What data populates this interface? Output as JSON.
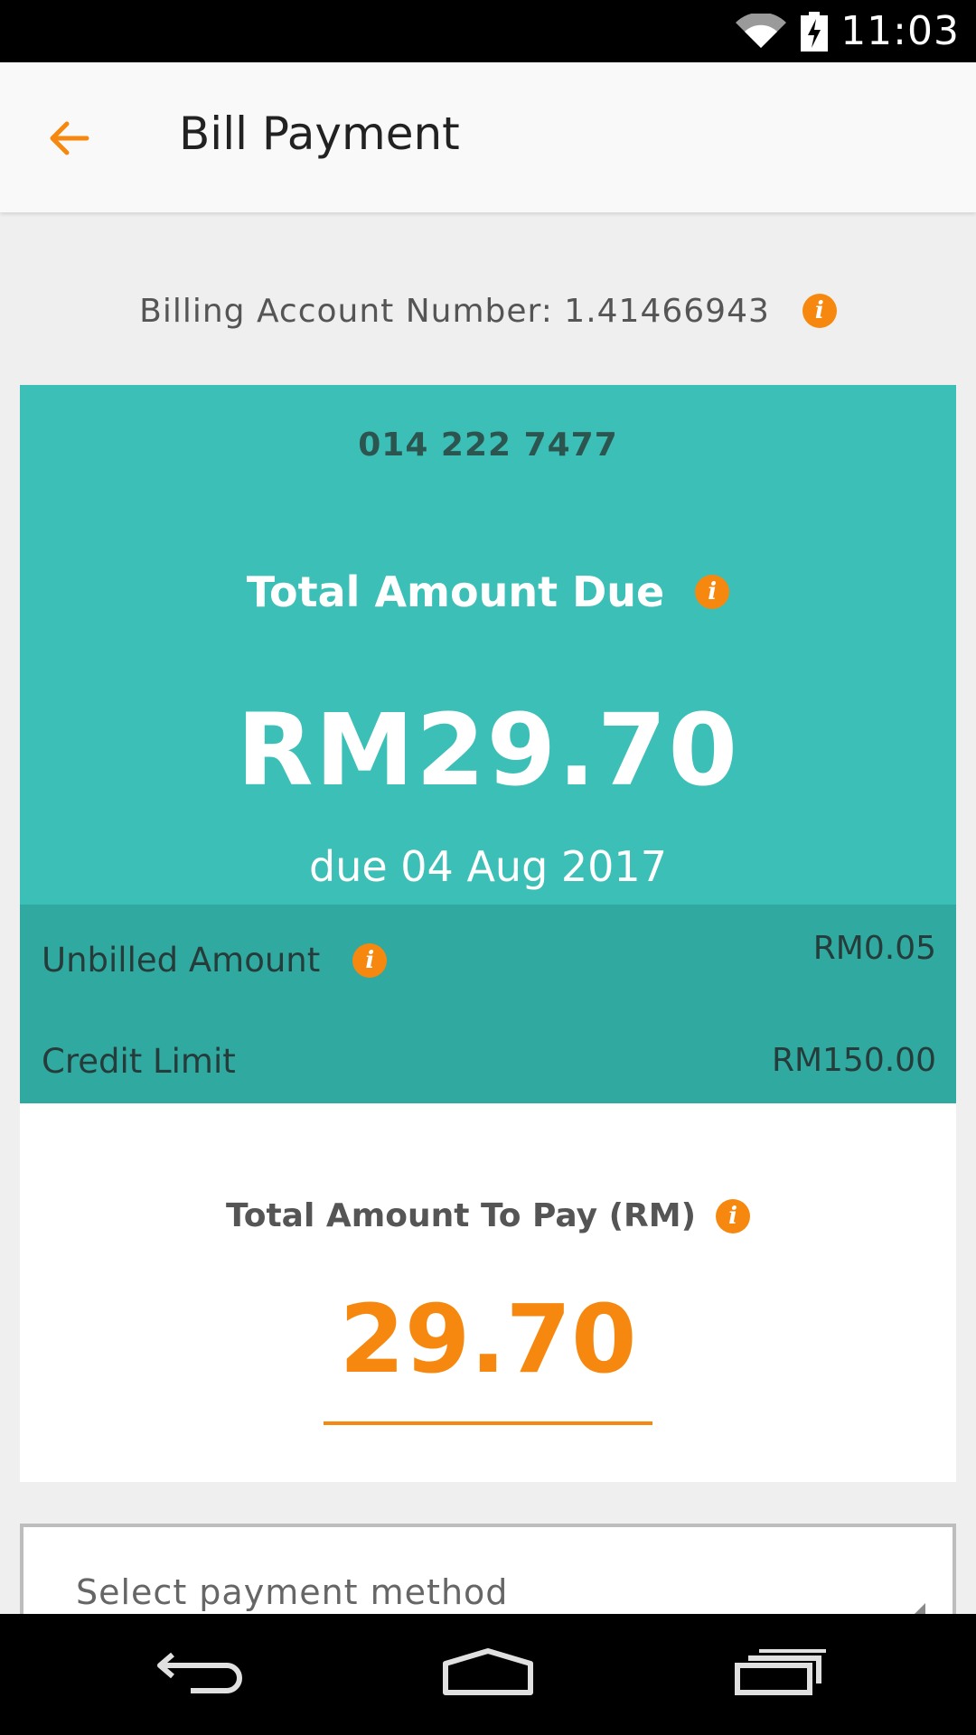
{
  "status_bar": {
    "time": "11:03",
    "icons": [
      "wifi-icon",
      "battery-charging-icon"
    ]
  },
  "header": {
    "title": "Bill Payment",
    "back_icon": "arrow-left-icon"
  },
  "account": {
    "label": "Billing Account Number: 1.41466943",
    "info_icon": "info-icon"
  },
  "due_card": {
    "phone_number": "014 222 7477",
    "label": "Total Amount Due",
    "amount": "RM29.70",
    "due_date": "due 04 Aug 2017"
  },
  "summary": {
    "unbilled_label": "Unbilled Amount",
    "unbilled_value": "RM0.05",
    "credit_label": "Credit Limit",
    "credit_value": "RM150.00"
  },
  "payment": {
    "label": "Total Amount To Pay (RM)",
    "amount_value": "29.70"
  },
  "method": {
    "placeholder": "Select payment method"
  },
  "nav_bar": {
    "buttons": [
      "back-nav-icon",
      "home-nav-icon",
      "recents-nav-icon"
    ]
  },
  "colors": {
    "accent": "#f7880f",
    "teal": "#3bbfb6",
    "teal_dark": "#30a9a1",
    "background": "#efefef"
  }
}
